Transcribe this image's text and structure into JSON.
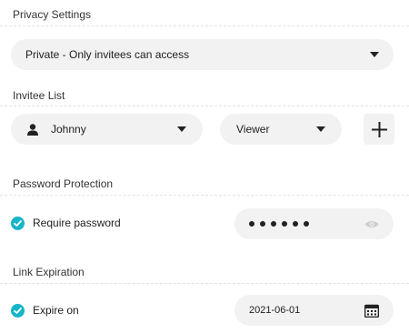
{
  "privacy": {
    "title": "Privacy Settings",
    "selected": "Private - Only invitees can access"
  },
  "invitees": {
    "title": "Invitee List",
    "user_name": "Johnny",
    "role": "Viewer",
    "user_icon": "person-icon",
    "add_icon": "plus-icon"
  },
  "password": {
    "title": "Password Protection",
    "checkbox_label": "Require password",
    "checked": true,
    "masked_value": "••••••",
    "toggle_icon": "eye-icon"
  },
  "expiration": {
    "title": "Link Expiration",
    "checkbox_label": "Expire on",
    "checked": true,
    "date": "2021-06-01",
    "calendar_icon": "calendar-icon"
  },
  "colors": {
    "accent": "#16b5c9",
    "pill_bg": "#f2f2f2"
  }
}
